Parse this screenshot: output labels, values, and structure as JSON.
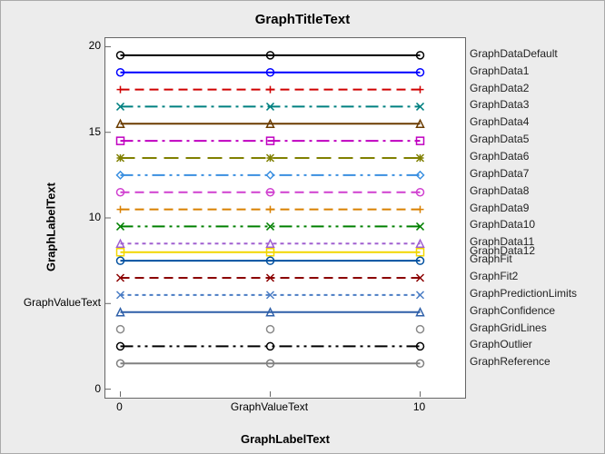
{
  "title": "GraphTitleText",
  "xlabel": "GraphLabelText",
  "ylabel": "GraphLabelText",
  "x_ticks": [
    {
      "value": 0,
      "label": "0"
    },
    {
      "value": 5,
      "label": "GraphValueText"
    },
    {
      "value": 10,
      "label": "10"
    }
  ],
  "y_ticks": [
    {
      "value": 0,
      "label": "0"
    },
    {
      "value": 5,
      "label": "GraphValueText"
    },
    {
      "value": 10,
      "label": "10"
    },
    {
      "value": 15,
      "label": "15"
    },
    {
      "value": 20,
      "label": "20"
    }
  ],
  "axes": {
    "x_range": [
      -0.5,
      11.5
    ],
    "y_range": [
      -0.5,
      20.5
    ]
  },
  "chart_data": {
    "type": "line",
    "title": "GraphTitleText",
    "xlabel": "GraphLabelText",
    "ylabel": "GraphLabelText",
    "xlim": [
      -0.5,
      11.5
    ],
    "ylim": [
      -0.5,
      20.5
    ],
    "x": [
      0,
      5,
      10
    ],
    "series": [
      {
        "name": "GraphDataDefault",
        "values": [
          19.5,
          19.5,
          19.5
        ],
        "color": "#000000",
        "dash": "solid",
        "marker": "o"
      },
      {
        "name": "GraphData1",
        "values": [
          18.5,
          18.5,
          18.5
        ],
        "color": "#0000FF",
        "dash": "solid",
        "marker": "o"
      },
      {
        "name": "GraphData2",
        "values": [
          17.5,
          17.5,
          17.5
        ],
        "color": "#D00000",
        "dash": "dash",
        "marker": "plus"
      },
      {
        "name": "GraphData3",
        "values": [
          16.5,
          16.5,
          16.5
        ],
        "color": "#008080",
        "dash": "dashdot",
        "marker": "x"
      },
      {
        "name": "GraphData4",
        "values": [
          15.5,
          15.5,
          15.5
        ],
        "color": "#6B3C00",
        "dash": "solid",
        "marker": "tri"
      },
      {
        "name": "GraphData5",
        "values": [
          14.5,
          14.5,
          14.5
        ],
        "color": "#C000C0",
        "dash": "dashdot",
        "marker": "sq"
      },
      {
        "name": "GraphData6",
        "values": [
          13.5,
          13.5,
          13.5
        ],
        "color": "#808000",
        "dash": "longdash",
        "marker": "star"
      },
      {
        "name": "GraphData7",
        "values": [
          12.5,
          12.5,
          12.5
        ],
        "color": "#3A8FE0",
        "dash": "dashdotdot",
        "marker": "diamond"
      },
      {
        "name": "GraphData8",
        "values": [
          11.5,
          11.5,
          11.5
        ],
        "color": "#D040D0",
        "dash": "dash",
        "marker": "o"
      },
      {
        "name": "GraphData9",
        "values": [
          10.5,
          10.5,
          10.5
        ],
        "color": "#D98000",
        "dash": "dash",
        "marker": "plus"
      },
      {
        "name": "GraphData10",
        "values": [
          9.5,
          9.5,
          9.5
        ],
        "color": "#008000",
        "dash": "dashdotdot",
        "marker": "x"
      },
      {
        "name": "GraphData11",
        "values": [
          8.5,
          8.5,
          8.5
        ],
        "color": "#A060D0",
        "dash": "shortdash",
        "marker": "tri"
      },
      {
        "name": "GraphData12",
        "values": [
          8.0,
          8.0,
          8.0
        ],
        "color": "#F2D600",
        "dash": "solid",
        "marker": "sq"
      },
      {
        "name": "GraphFit",
        "values": [
          7.5,
          7.5,
          7.5
        ],
        "color": "#0050A0",
        "dash": "solid",
        "marker": "o"
      },
      {
        "name": "GraphFit2",
        "values": [
          6.5,
          6.5,
          6.5
        ],
        "color": "#8B0000",
        "dash": "dash",
        "marker": "x"
      },
      {
        "name": "GraphPredictionLimits",
        "values": [
          5.5,
          5.5,
          5.5
        ],
        "color": "#4A7CC4",
        "dash": "shortdash",
        "marker": "x"
      },
      {
        "name": "GraphConfidence",
        "values": [
          4.5,
          4.5,
          4.5
        ],
        "color": "#2E5FA8",
        "dash": "solid",
        "marker": "tri"
      },
      {
        "name": "GraphGridLines",
        "values": [
          3.5,
          3.5,
          3.5
        ],
        "color": "#888888",
        "dash": "none",
        "marker": "o"
      },
      {
        "name": "GraphOutlier",
        "values": [
          2.5,
          2.5,
          2.5
        ],
        "color": "#000000",
        "dash": "dashdotdot",
        "marker": "o"
      },
      {
        "name": "GraphReference",
        "values": [
          1.5,
          1.5,
          1.5
        ],
        "color": "#808080",
        "dash": "solid",
        "marker": "o"
      }
    ]
  }
}
